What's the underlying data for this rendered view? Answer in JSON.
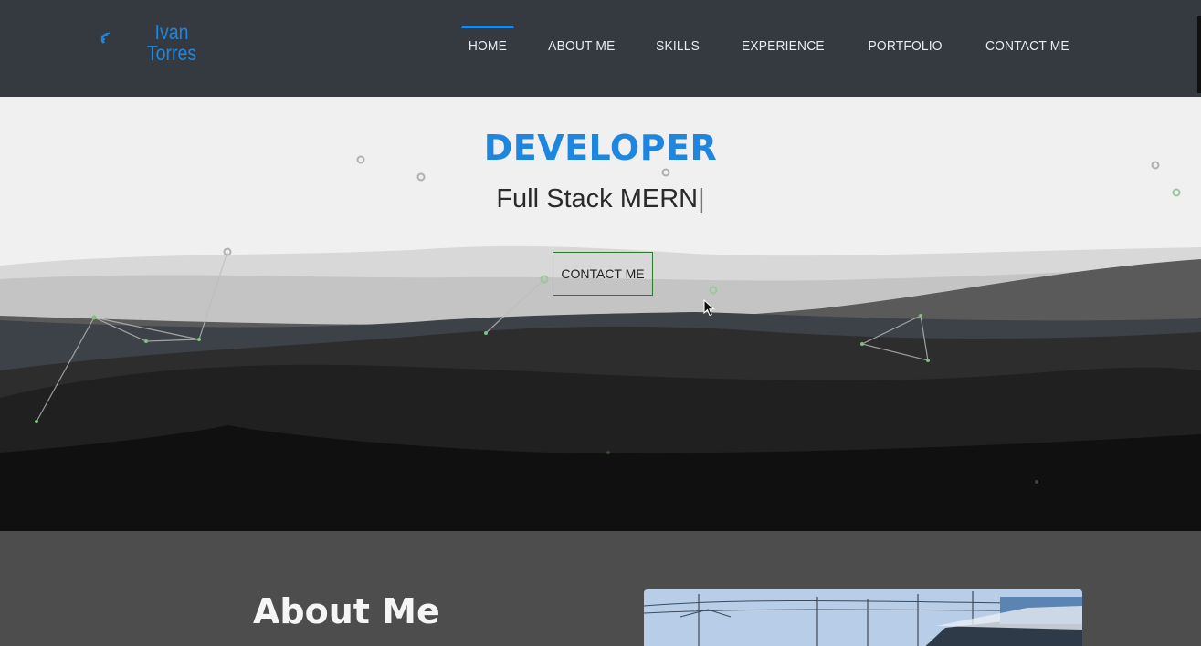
{
  "brand": {
    "first_name": "Ivan",
    "last_name": "Torres",
    "accent_color": "#1f86e0"
  },
  "nav": {
    "items": [
      {
        "label": "HOME",
        "active": true
      },
      {
        "label": "ABOUT ME",
        "active": false
      },
      {
        "label": "SKILLS",
        "active": false
      },
      {
        "label": "EXPERIENCE",
        "active": false
      },
      {
        "label": "PORTFOLIO",
        "active": false
      },
      {
        "label": "CONTACT ME",
        "active": false
      }
    ]
  },
  "hero": {
    "title": "DEVELOPER",
    "subtitle": "Full Stack MERN",
    "caret": "|",
    "cta_label": "CONTACT ME",
    "cta_border_color": "#2d7a2d"
  },
  "about": {
    "title": "About Me"
  },
  "icons": {
    "logo": "signal-waves-icon",
    "cursor": "mouse-pointer-icon"
  }
}
